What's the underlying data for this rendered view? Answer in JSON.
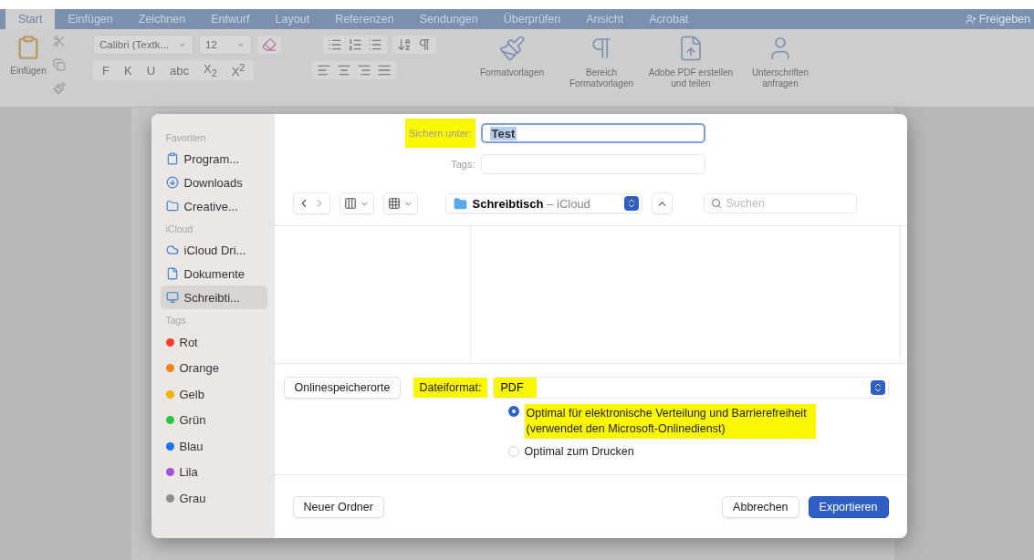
{
  "tabs": [
    {
      "label": "Start",
      "selected": true
    },
    {
      "label": "Einfügen",
      "selected": false
    },
    {
      "label": "Zeichnen",
      "selected": false
    },
    {
      "label": "Entwurf",
      "selected": false
    },
    {
      "label": "Layout",
      "selected": false
    },
    {
      "label": "Referenzen",
      "selected": false
    },
    {
      "label": "Sendungen",
      "selected": false
    },
    {
      "label": "Überprüfen",
      "selected": false
    },
    {
      "label": "Ansicht",
      "selected": false
    },
    {
      "label": "Acrobat",
      "selected": false
    }
  ],
  "share_button": "Freigeben",
  "ribbon": {
    "paste_label": "Einfügen",
    "font_name": "Calibri (Textk...",
    "font_size": "12",
    "format_buttons": [
      "F",
      "K",
      "U",
      "abc",
      "X$_{2}$",
      "X$^{2}$"
    ],
    "large_buttons": [
      {
        "label": "Formatvorlagen"
      },
      {
        "label": "Bereich Formatvorlagen"
      },
      {
        "label": "Adobe PDF erstellen und teilen"
      },
      {
        "label": "Unterschriften anfragen"
      }
    ]
  },
  "dialog": {
    "sidebar": [
      {
        "heading": "Favoriten",
        "items": [
          {
            "label": "Program...",
            "selected": false
          },
          {
            "label": "Downloads",
            "selected": false
          },
          {
            "label": "Creative...",
            "selected": false
          }
        ]
      },
      {
        "heading": "iCloud",
        "items": [
          {
            "label": "iCloud Dri...",
            "selected": false
          },
          {
            "label": "Dokumente",
            "selected": false
          },
          {
            "label": "Schreibti...",
            "selected": true
          }
        ]
      },
      {
        "heading": "Tags",
        "tags": [
          {
            "label": "Rot",
            "color": "#ff3b30"
          },
          {
            "label": "Orange",
            "color": "#f5821f"
          },
          {
            "label": "Gelb",
            "color": "#f4b400"
          },
          {
            "label": "Grün",
            "color": "#28c840"
          },
          {
            "label": "Blau",
            "color": "#1a73e8"
          },
          {
            "label": "Lila",
            "color": "#a550d6"
          },
          {
            "label": "Grau",
            "color": "#8e8e8e"
          }
        ]
      }
    ],
    "save_as": {
      "label": "Sichern unter:",
      "value": "Test",
      "highlighted": true
    },
    "tags_field": {
      "label": "Tags:"
    },
    "location": {
      "name": "Schreibtisch",
      "suffix": "– iCloud"
    },
    "search": {
      "placeholder": "Suchen"
    },
    "online_button": "Onlinespeicherorte",
    "file_format": {
      "label": "Dateiformat:",
      "value": "PDF",
      "highlighted": true
    },
    "options": [
      {
        "label": "Optimal für elektronische Verteilung und Barrierefreiheit",
        "note": "(verwendet den Microsoft-Onlinedienst)",
        "selected": true,
        "highlighted": true
      },
      {
        "label": "Optimal zum Drucken",
        "selected": false,
        "highlighted": false
      }
    ],
    "new_folder_button": "Neuer Ordner",
    "cancel_button": "Abbrechen",
    "export_button": "Exportieren"
  }
}
